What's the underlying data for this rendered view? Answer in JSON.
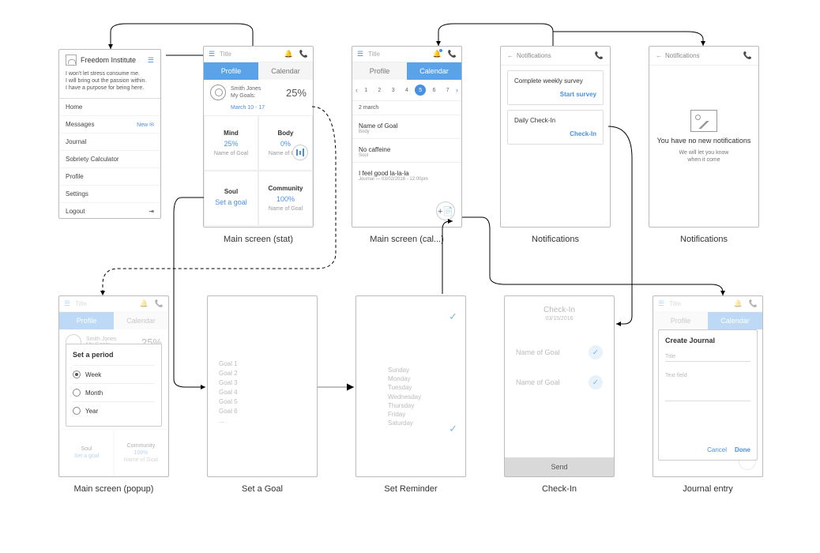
{
  "freedom": {
    "title": "Freedom Institute",
    "quote": "I won't let stress consume me.\nI will bring out the passion within.\nI have a purpose for being here.",
    "menu": [
      "Home",
      "Messages",
      "Journal",
      "Sobriety Calculator",
      "Profile",
      "Settings",
      "Logout"
    ],
    "new": "New"
  },
  "topbar": {
    "title": "Title"
  },
  "tabs": {
    "profile": "Profile",
    "calendar": "Calendar"
  },
  "stat": {
    "name": "Smith Jones",
    "goals_label": "My Goals:",
    "pct": "25%",
    "date": "March 10 - 17",
    "cells": {
      "mind": {
        "label": "Mind",
        "value": "25%",
        "goal": "Name of Goal"
      },
      "body": {
        "label": "Body",
        "value": "0%",
        "goal": "Name of Goal"
      },
      "soul": {
        "label": "Soul",
        "value": "Set a goal",
        "goal": ""
      },
      "community": {
        "label": "Community",
        "value": "100%",
        "goal": "Name of Goal"
      }
    },
    "screen_label": "Main screen (stat)"
  },
  "cal": {
    "days": [
      "1",
      "2",
      "3",
      "4",
      "5",
      "6",
      "7"
    ],
    "selected": "5",
    "date_header": "2 march",
    "goal1": {
      "name": "Name of Goal",
      "sub": "Body"
    },
    "goal2": {
      "name": "No caffeine",
      "sub": "Soul"
    },
    "journal": {
      "name": "I feel good la-la-la",
      "sub": "Journal  —  03/02/2016 - 12:00pm"
    },
    "screen_label": "Main screen (cal...)"
  },
  "notif": {
    "back": "Notifications",
    "survey": {
      "title": "Complete weekly survey",
      "action": "Start survey"
    },
    "checkin": {
      "title": "Daily Check-In",
      "action": "Check-In"
    },
    "screen_label": "Notifications"
  },
  "notif2": {
    "back": "Notifications",
    "msg": "You have no new notifications",
    "sub": "We will let you know\nwhen it come",
    "screen_label": "Notifications"
  },
  "popup": {
    "title": "Set a period",
    "options": [
      "Week",
      "Month",
      "Year"
    ],
    "soul": "Soul",
    "setgoal": "Set a goal",
    "community": "Community",
    "c_val": "100%",
    "c_goal": "Name of Goal",
    "screen_label": "Main screen (popup)"
  },
  "setgoal": {
    "goals": [
      "Goal 1",
      "Goal 2",
      "Goal 3",
      "Goal 4",
      "Goal 5",
      "Goal 6",
      "..."
    ],
    "screen_label": "Set a Goal"
  },
  "reminder": {
    "days": [
      "Sunday",
      "Monday",
      "Tuesday",
      "Wednesday",
      "Thursday",
      "Friday",
      "Saturday"
    ],
    "screen_label": "Set Reminder"
  },
  "checkin": {
    "title": "Check-In",
    "date": "03/15/2016",
    "goal": "Name of Goal",
    "send": "Send",
    "screen_label": "Check-In"
  },
  "journal": {
    "title": "Create Journal",
    "field1": "Title",
    "field2": "Text field",
    "cancel": "Cancel",
    "done": "Done",
    "screen_label": "Journal entry"
  }
}
